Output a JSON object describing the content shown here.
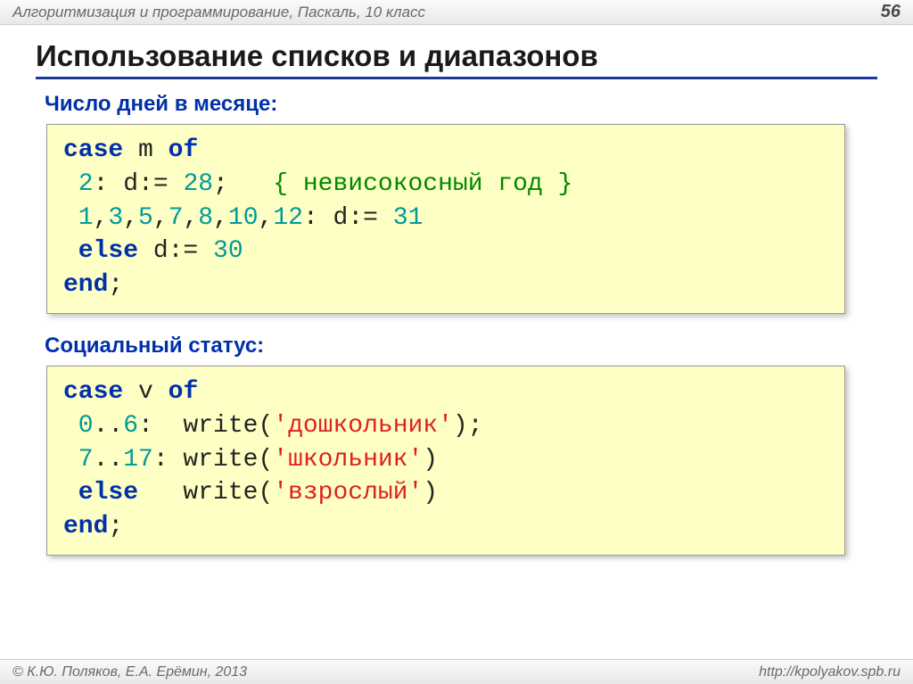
{
  "header": {
    "breadcrumb": "Алгоритмизация и программирование, Паскаль, 10 класс",
    "page_number": "56"
  },
  "title": "Использование списков и диапазонов",
  "section1": {
    "heading": "Число дней в месяце:",
    "code": {
      "l1_a": "case",
      "l1_b": " m ",
      "l1_c": "of",
      "l2_a": " 2",
      "l2_b": ": d:= ",
      "l2_c": "28",
      "l2_d": ";   ",
      "l2_e": "{ невисокосный год }",
      "l3_a": " 1",
      "l3_b": ",",
      "l3_c": "3",
      "l3_d": ",",
      "l3_e": "5",
      "l3_f": ",",
      "l3_g": "7",
      "l3_h": ",",
      "l3_i": "8",
      "l3_j": ",",
      "l3_k": "10",
      "l3_l": ",",
      "l3_m": "12",
      "l3_n": ": d:= ",
      "l3_o": "31",
      "l4_a": " else",
      "l4_b": " d:= ",
      "l4_c": "30",
      "l5_a": "end",
      "l5_b": ";"
    }
  },
  "section2": {
    "heading": "Социальный статус:",
    "code": {
      "l1_a": "case",
      "l1_b": " v ",
      "l1_c": "of",
      "l2_a": " 0",
      "l2_b": "..",
      "l2_c": "6",
      "l2_d": ":  write(",
      "l2_e": "'дошкольник'",
      "l2_f": ");",
      "l3_a": " 7",
      "l3_b": "..",
      "l3_c": "17",
      "l3_d": ": write(",
      "l3_e": "'школьник'",
      "l3_f": ")",
      "l4_a": " else",
      "l4_b": "   write(",
      "l4_c": "'взрослый'",
      "l4_d": ")",
      "l5_a": "end",
      "l5_b": ";"
    }
  },
  "footer": {
    "copyright": "© К.Ю. Поляков, Е.А. Ерёмин, 2013",
    "url": "http://kpolyakov.spb.ru"
  }
}
